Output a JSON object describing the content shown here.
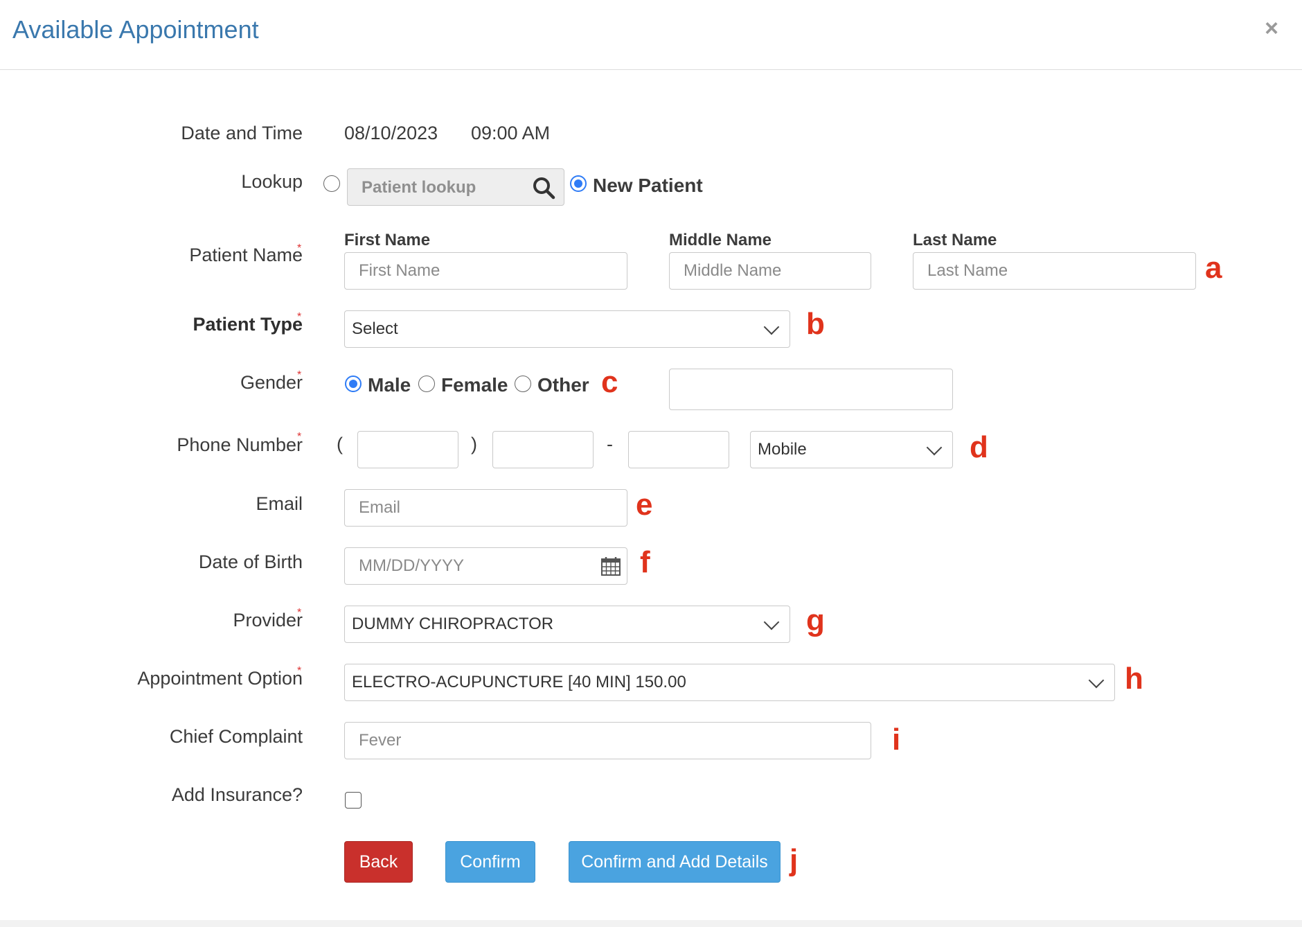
{
  "modal": {
    "title": "Available Appointment",
    "close_glyph": "×"
  },
  "labels": {
    "date_time": "Date and Time",
    "lookup": "Lookup",
    "patient_name": "Patient Name",
    "patient_type": "Patient Type",
    "gender": "Gender",
    "phone_number": "Phone Number",
    "email": "Email",
    "date_of_birth": "Date of Birth",
    "provider": "Provider",
    "appointment_option": "Appointment Option",
    "chief_complaint": "Chief Complaint",
    "add_insurance": "Add Insurance?",
    "required_mark": "*"
  },
  "appointment": {
    "date": "08/10/2023",
    "time": "09:00 AM"
  },
  "lookup": {
    "placeholder": "Patient lookup",
    "new_patient_label": "New Patient",
    "selected": "New Patient"
  },
  "name_fields": {
    "first_header": "First Name",
    "middle_header": "Middle Name",
    "last_header": "Last Name",
    "first_placeholder": "First Name",
    "middle_placeholder": "Middle Name",
    "last_placeholder": "Last Name"
  },
  "patient_type": {
    "selected": "Select"
  },
  "gender": {
    "options": [
      "Male",
      "Female",
      "Other"
    ],
    "selected": "Male"
  },
  "phone": {
    "open_paren": "(",
    "close_paren": ")",
    "dash": "-",
    "type_selected": "Mobile"
  },
  "email": {
    "placeholder": "Email"
  },
  "dob": {
    "placeholder": "MM/DD/YYYY"
  },
  "provider": {
    "selected": "DUMMY CHIROPRACTOR"
  },
  "appointment_option": {
    "selected": "ELECTRO-ACUPUNCTURE [40 MIN] 150.00"
  },
  "chief_complaint": {
    "placeholder": "Fever"
  },
  "insurance": {
    "checked": false
  },
  "buttons": {
    "back": "Back",
    "confirm": "Confirm",
    "confirm_add_details": "Confirm and Add Details"
  },
  "annotation_marks": [
    "a",
    "b",
    "c",
    "d",
    "e",
    "f",
    "g",
    "h",
    "i",
    "j"
  ],
  "colors": {
    "title": "#3a78ad",
    "accent_blue": "#4aa3e0",
    "back_red": "#c9302c",
    "annotation_red": "#e0331c",
    "radio_blue": "#2f7cf6"
  }
}
